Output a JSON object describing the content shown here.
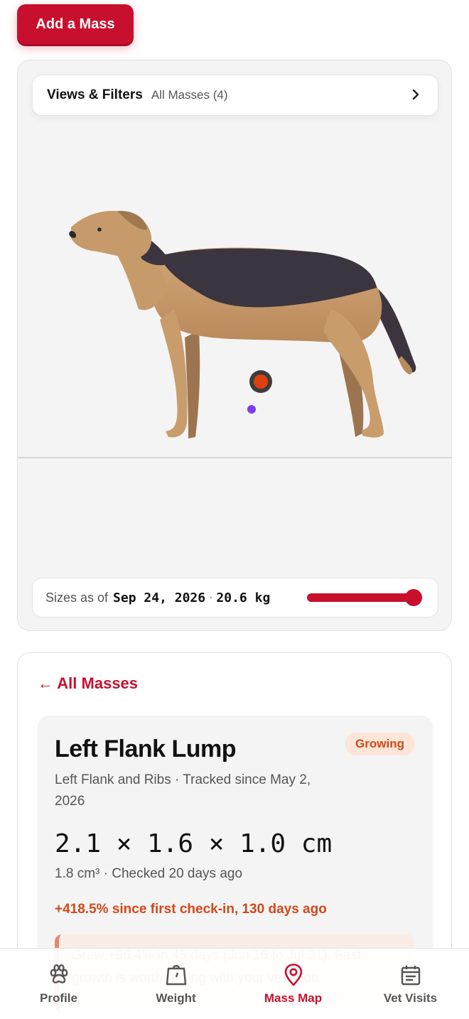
{
  "header": {
    "add_button_label": "Add a Mass"
  },
  "filters": {
    "title": "Views & Filters",
    "value": "All Masses (4)"
  },
  "sizes_bar": {
    "label": "Sizes as of",
    "date": "Sep 24, 2026",
    "separator": "·",
    "weight": "20.6 kg",
    "slider_position": 1.0
  },
  "back_link": "← All Masses",
  "mass": {
    "title": "Left Flank Lump",
    "status_badge": "Growing",
    "subtitle": "Left Flank and Ribs · Tracked since May 2, 2026",
    "dimensions": "2.1 × 1.6 × 1.0 cm",
    "volume_line": "1.8 cm³ · Checked 20 days ago",
    "growth_line": "+418.5% since first check-in, 130 days ago",
    "alert_text": "Grew +96.4% in 45 days (Jun 16 to Jul 31). Fast growth is worth raising with your vet soon."
  },
  "nav": {
    "items": [
      {
        "label": "Profile",
        "icon": "paw-icon"
      },
      {
        "label": "Weight",
        "icon": "scale-icon"
      },
      {
        "label": "Mass Map",
        "icon": "map-pin-icon"
      },
      {
        "label": "Vet Visits",
        "icon": "calendar-icon"
      }
    ],
    "active_index": 2
  },
  "colors": {
    "accent": "#c8102e",
    "warning": "#d2481a",
    "badge_bg": "#fde6d8",
    "card_bg": "#f4f4f4"
  }
}
